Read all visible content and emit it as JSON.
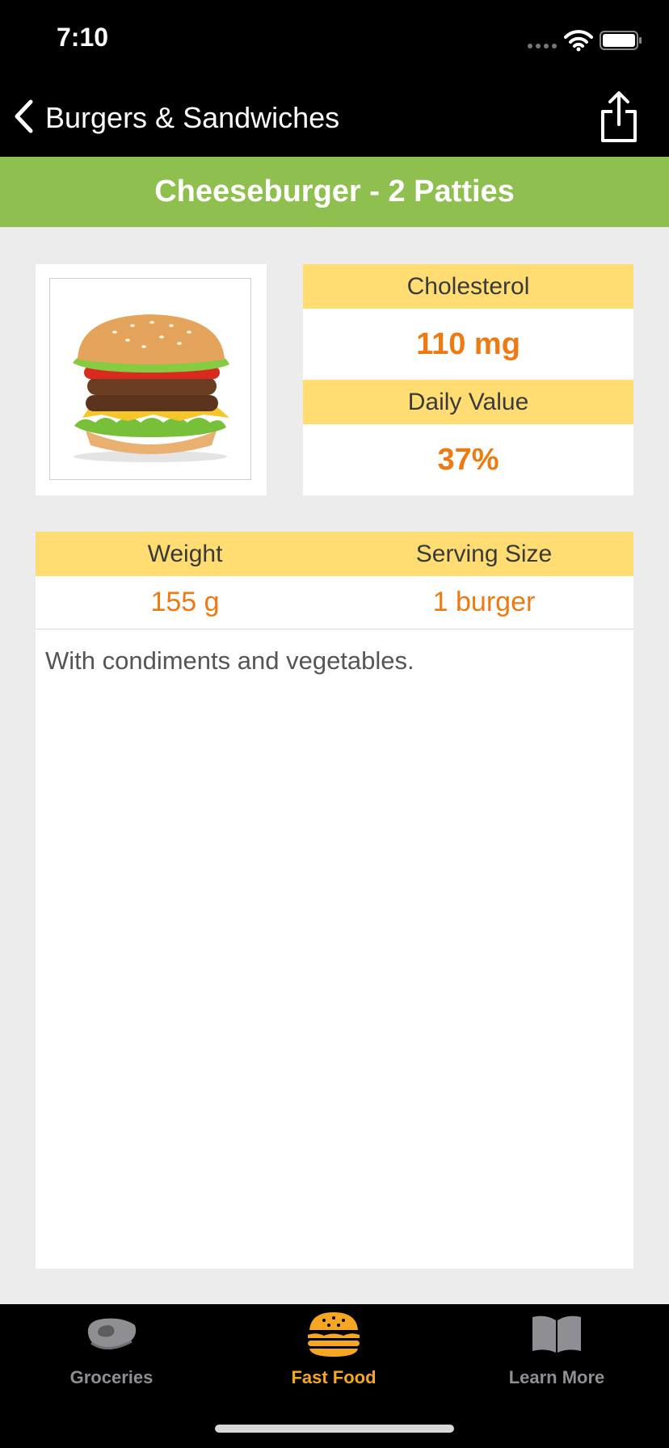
{
  "status_bar": {
    "time": "7:10"
  },
  "nav": {
    "back_label": "Burgers & Sandwiches"
  },
  "title": "Cheeseburger - 2 Patties",
  "nutrient": {
    "label": "Cholesterol",
    "value": "110 mg",
    "daily_value_label": "Daily Value",
    "daily_value": "37%"
  },
  "serving": {
    "weight_label": "Weight",
    "weight_value": "155 g",
    "size_label": "Serving Size",
    "size_value": "1 burger",
    "description": "With condiments and vegetables."
  },
  "tabs": [
    {
      "label": "Groceries",
      "icon": "steak-icon",
      "active": false
    },
    {
      "label": "Fast Food",
      "icon": "burger-icon",
      "active": true
    },
    {
      "label": "Learn More",
      "icon": "book-icon",
      "active": false
    }
  ],
  "colors": {
    "banner": "#8FBF4E",
    "label_band": "#FFDD73",
    "value_text": "#EE7A12",
    "active_tab": "#F5A623",
    "inactive_tab": "#8E8E93"
  }
}
